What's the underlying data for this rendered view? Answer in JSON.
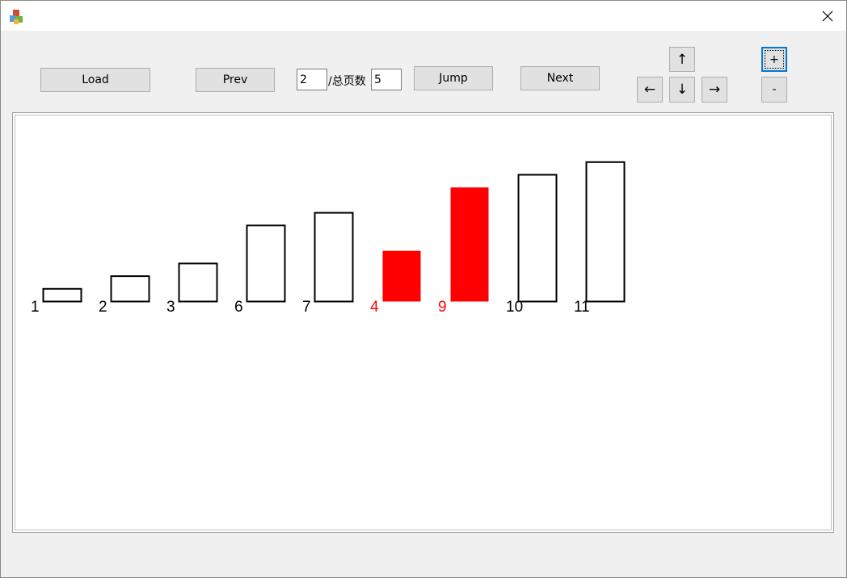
{
  "window": {
    "title": ""
  },
  "toolbar": {
    "load_label": "Load",
    "prev_label": "Prev",
    "page_value": "2",
    "separator_label": "/总页数",
    "total_value": "5",
    "jump_label": "Jump",
    "next_label": "Next",
    "up_label": "↑",
    "left_label": "←",
    "down_label": "↓",
    "right_label": "→",
    "zoom_in_label": "+",
    "zoom_out_label": "-"
  },
  "chart_data": {
    "type": "bar",
    "categories": [
      "1",
      "2",
      "3",
      "6",
      "7",
      "4",
      "9",
      "10",
      "11"
    ],
    "values": [
      1,
      2,
      3,
      6,
      7,
      4,
      9,
      10,
      11
    ],
    "highlighted": [
      false,
      false,
      false,
      false,
      false,
      true,
      true,
      false,
      false
    ],
    "colors": {
      "normal_stroke": "#000000",
      "highlight_fill": "#ff0000",
      "highlight_text": "#ff0000"
    },
    "title": "",
    "xlabel": "",
    "ylabel": ""
  }
}
